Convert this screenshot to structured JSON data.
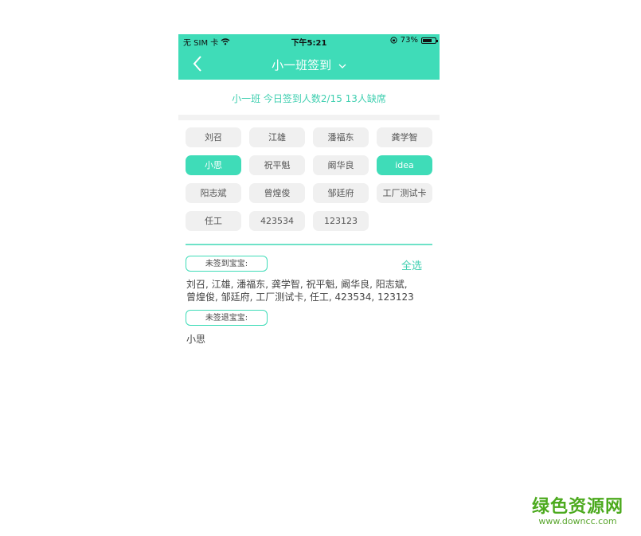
{
  "status_bar": {
    "carrier": "无 SIM 卡",
    "time": "下午5:21",
    "battery": "73%",
    "battery_level": 0.73
  },
  "nav": {
    "title": "小一班签到"
  },
  "summary": "小一班  今日签到人数2/15    13人缺席",
  "students": [
    {
      "name": "刘召",
      "active": false
    },
    {
      "name": "江雄",
      "active": false
    },
    {
      "name": "潘福东",
      "active": false
    },
    {
      "name": "龚学智",
      "active": false
    },
    {
      "name": "小思",
      "active": true
    },
    {
      "name": "祝平魁",
      "active": false
    },
    {
      "name": "阚华良",
      "active": false
    },
    {
      "name": "idea",
      "active": true
    },
    {
      "name": "阳志斌",
      "active": false
    },
    {
      "name": "曾煌俊",
      "active": false
    },
    {
      "name": "邹廷府",
      "active": false
    },
    {
      "name": "工厂测试卡",
      "active": false
    },
    {
      "name": "任工",
      "active": false
    },
    {
      "name": "423534",
      "active": false
    },
    {
      "name": "123123",
      "active": false
    }
  ],
  "unsigned_in": {
    "label": "未签到宝宝:",
    "select_all": "全选",
    "line1": "刘召, 江雄, 潘福东, 龚学智, 祝平魁, 阚华良, 阳志斌,",
    "line2": "曾煌俊, 邹廷府, 工厂测试卡, 任工, 423534, 123123"
  },
  "unsigned_out": {
    "label": "未签退宝宝:",
    "names": "小思"
  },
  "watermark": {
    "main": "绿色资源网",
    "sub": "www.downcc.com"
  },
  "colors": {
    "accent": "#3fdcb8",
    "chip_bg": "#f0f0f0",
    "watermark": "#4caa1e"
  }
}
